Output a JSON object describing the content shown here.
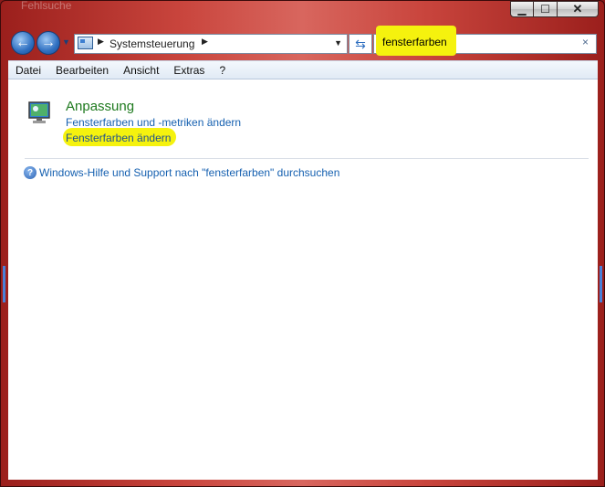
{
  "window": {
    "title": "Fehlsuche"
  },
  "nav": {
    "back_label": "←",
    "forward_label": "→",
    "breadcrumb": "Systemsteuerung",
    "search_value": "fensterfarben",
    "clear_label": "×"
  },
  "menu": [
    "Datei",
    "Bearbeiten",
    "Ansicht",
    "Extras",
    "?"
  ],
  "result": {
    "title": "Anpassung",
    "link1": "Fensterfarben und -metriken ändern",
    "link2": "Fensterfarben ändern"
  },
  "help_link": "Windows-Hilfe und Support nach \"fensterfarben\" durchsuchen",
  "colors": {
    "highlight": "#f5f20e",
    "link": "#1560b0",
    "title_green": "#1e7a1e",
    "frame": "#c9453d"
  }
}
